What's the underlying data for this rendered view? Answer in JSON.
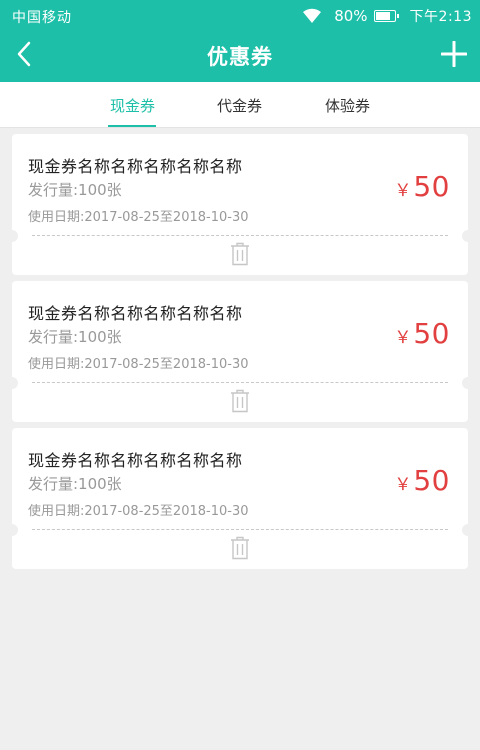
{
  "status_bar": {
    "carrier": "中国移动",
    "battery_percent": "80%",
    "battery_level": 0.8,
    "time": "下午2:13"
  },
  "nav": {
    "title": "优惠券",
    "back_icon": "chevron-left-icon",
    "add_icon": "plus-icon"
  },
  "tabs": [
    {
      "label": "现金券",
      "active": true
    },
    {
      "label": "代金券",
      "active": false
    },
    {
      "label": "体验券",
      "active": false
    }
  ],
  "coupons": [
    {
      "name": "现金券名称名称名称名称名称",
      "issue": "发行量:100张",
      "date": "使用日期:2017-08-25至2018-10-30",
      "currency": "￥",
      "amount": "50"
    },
    {
      "name": "现金券名称名称名称名称名称",
      "issue": "发行量:100张",
      "date": "使用日期:2017-08-25至2018-10-30",
      "currency": "￥",
      "amount": "50"
    },
    {
      "name": "现金券名称名称名称名称名称",
      "issue": "发行量:100张",
      "date": "使用日期:2017-08-25至2018-10-30",
      "currency": "￥",
      "amount": "50"
    }
  ],
  "colors": {
    "primary": "#1dbfa8",
    "price": "#e24040",
    "background": "#efefef"
  }
}
